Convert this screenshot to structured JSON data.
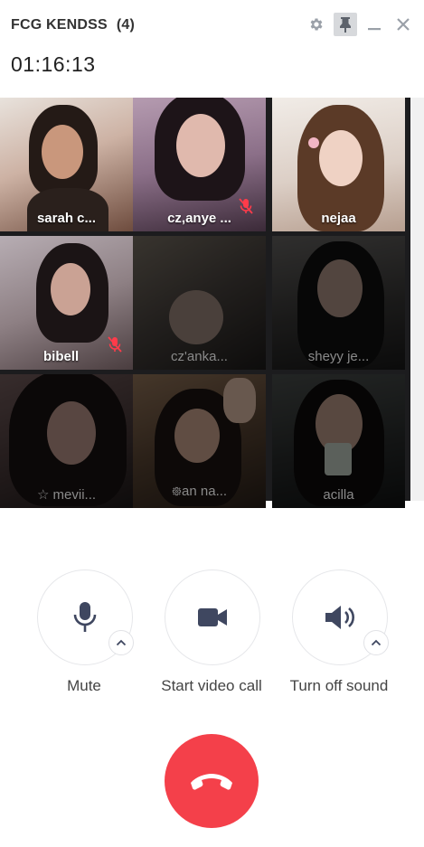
{
  "window": {
    "title": "FCG KENDSS",
    "participant_count": "(4)",
    "timer": "01:16:13",
    "controls": [
      "gear-icon",
      "pin-icon",
      "minimize-icon",
      "close-icon"
    ]
  },
  "participants": [
    {
      "name": "sarah c...",
      "muted": false,
      "video": true,
      "color": "#caa998"
    },
    {
      "name": "cz,anye ...",
      "muted": true,
      "video": true,
      "color": "#8d6f88"
    },
    {
      "name": "nejaa",
      "muted": false,
      "video": true,
      "color": "#d8c9bf"
    },
    {
      "name": "bibell",
      "muted": true,
      "video": true,
      "color": "#9c8c8e"
    },
    {
      "name": "cz'anka...",
      "muted": false,
      "video": false,
      "color": "#3a3633"
    },
    {
      "name": "sheyy je...",
      "muted": false,
      "video": false,
      "color": "#2f2e2d"
    },
    {
      "name": "☆ mevii...",
      "muted": false,
      "video": false,
      "color": "#3a2c2c"
    },
    {
      "name": "᪥an na...",
      "muted": false,
      "video": false,
      "color": "#4a3a31"
    },
    {
      "name": "acilla",
      "muted": false,
      "video": false,
      "color": "#2b2e2e"
    }
  ],
  "controls": {
    "mute_label": "Mute",
    "video_label": "Start video call",
    "sound_label": "Turn off sound"
  },
  "colors": {
    "hangup": "#f4404a",
    "icon": "#3f4760",
    "muted_icon": "#ff3b4a"
  }
}
